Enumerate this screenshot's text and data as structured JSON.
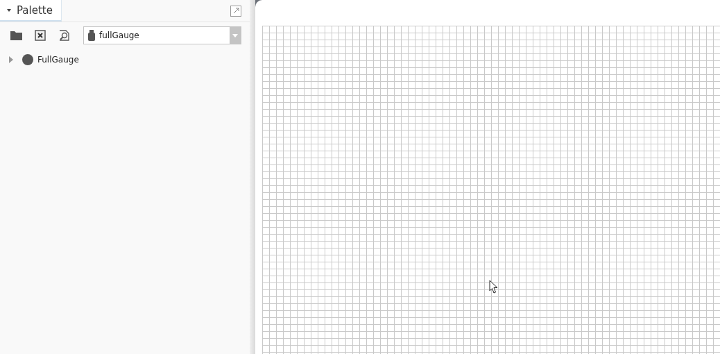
{
  "palette": {
    "title": "Palette",
    "expanded": true,
    "toolbar": {
      "dropdown": {
        "value": "fullGauge"
      }
    },
    "tree": [
      {
        "label": "FullGauge",
        "expanded": false
      }
    ]
  }
}
